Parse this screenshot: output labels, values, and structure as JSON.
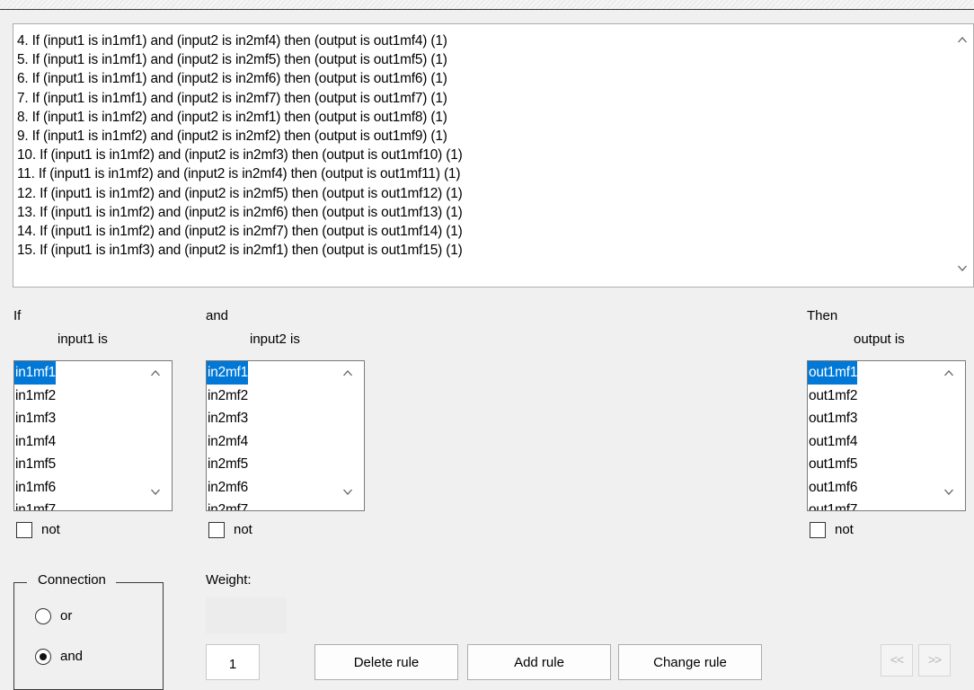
{
  "rules": [
    "4. If (input1 is in1mf1) and (input2 is in2mf4) then (output is out1mf4) (1)",
    "5. If (input1 is in1mf1) and (input2 is in2mf5) then (output is out1mf5) (1)",
    "6. If (input1 is in1mf1) and (input2 is in2mf6) then (output is out1mf6) (1)",
    "7. If (input1 is in1mf1) and (input2 is in2mf7) then (output is out1mf7) (1)",
    "8. If (input1 is in1mf2) and (input2 is in2mf1) then (output is out1mf8) (1)",
    "9. If (input1 is in1mf2) and (input2 is in2mf2) then (output is out1mf9) (1)",
    "10. If (input1 is in1mf2) and (input2 is in2mf3) then (output is out1mf10) (1)",
    "11. If (input1 is in1mf2) and (input2 is in2mf4) then (output is out1mf11) (1)",
    "12. If (input1 is in1mf2) and (input2 is in2mf5) then (output is out1mf12) (1)",
    "13. If (input1 is in1mf2) and (input2 is in2mf6) then (output is out1mf13) (1)",
    "14. If (input1 is in1mf2) and (input2 is in2mf7) then (output is out1mf14) (1)",
    "15. If (input1 is in1mf3) and (input2 is in2mf1) then (output is out1mf15) (1)"
  ],
  "antecedent1": {
    "prefix": "If",
    "variable": "input1 is",
    "items": [
      "in1mf1",
      "in1mf2",
      "in1mf3",
      "in1mf4",
      "in1mf5",
      "in1mf6",
      "in1mf7"
    ],
    "selected": "in1mf1",
    "not_label": "not",
    "not_checked": false
  },
  "antecedent2": {
    "prefix": "and",
    "variable": "input2 is",
    "items": [
      "in2mf1",
      "in2mf2",
      "in2mf3",
      "in2mf4",
      "in2mf5",
      "in2mf6",
      "in2mf7"
    ],
    "selected": "in2mf1",
    "not_label": "not",
    "not_checked": false
  },
  "consequent": {
    "prefix": "Then",
    "variable": "output is",
    "items": [
      "out1mf1",
      "out1mf2",
      "out1mf3",
      "out1mf4",
      "out1mf5",
      "out1mf6",
      "out1mf7"
    ],
    "selected": "out1mf1",
    "not_label": "not",
    "not_checked": false
  },
  "connection": {
    "title": "Connection",
    "options": [
      "or",
      "and"
    ],
    "selected": "and"
  },
  "weight": {
    "label": "Weight:",
    "value": "1"
  },
  "buttons": {
    "delete": "Delete rule",
    "add": "Add rule",
    "change": "Change rule",
    "prev": "<<",
    "next": ">>"
  },
  "colors": {
    "selection": "#0078d7",
    "background": "#f0f0f0"
  }
}
